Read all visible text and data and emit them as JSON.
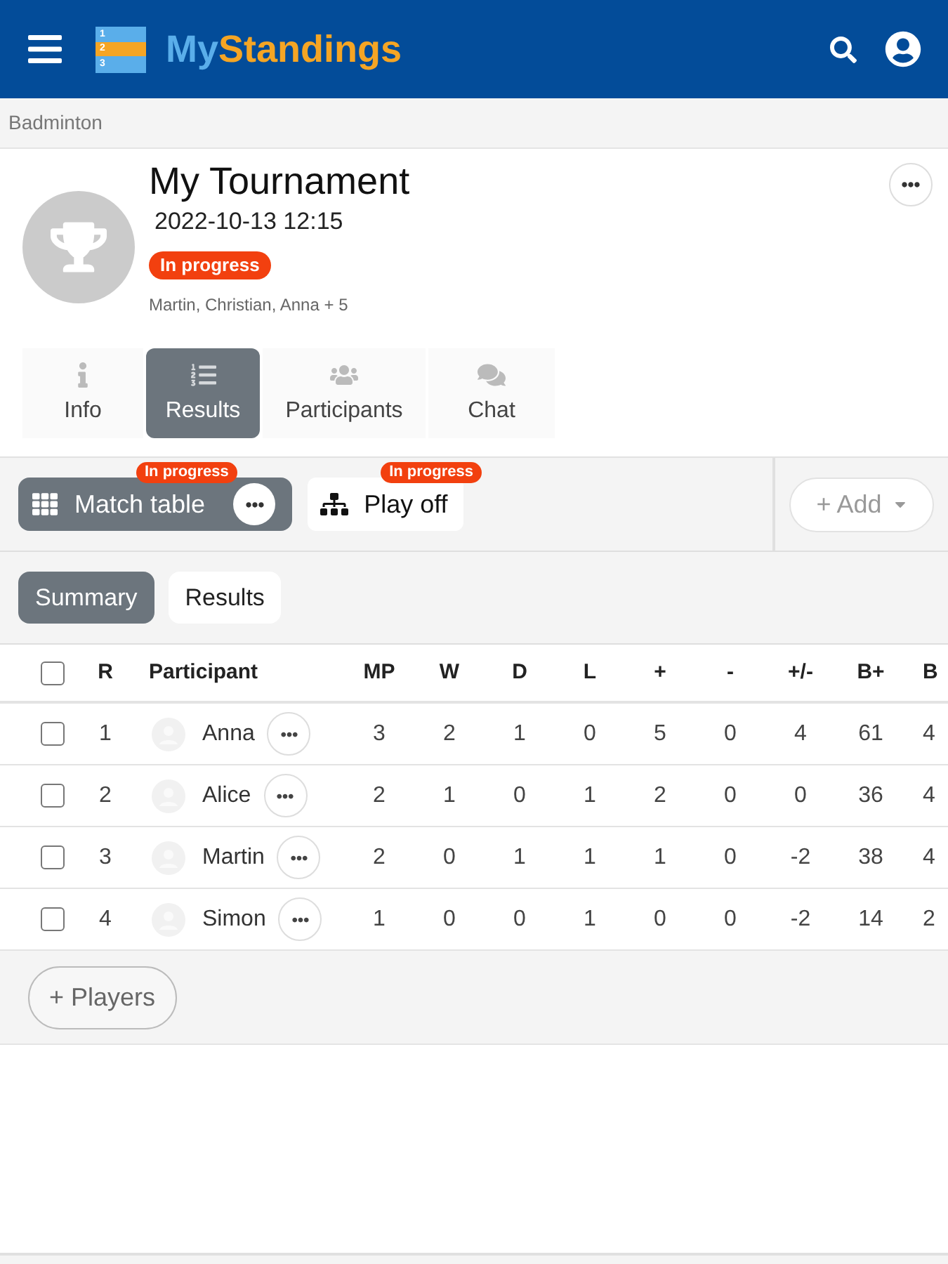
{
  "app_bar": {
    "logo": {
      "icon_numbers": [
        "1",
        "2",
        "3"
      ],
      "name_first": "My",
      "name_second": "Standings"
    }
  },
  "breadcrumb": "Badminton",
  "tournament": {
    "title": "My Tournament",
    "datetime": "2022-10-13 12:15",
    "status_badge": "In progress",
    "participants_summary": "Martin, Christian, Anna + 5"
  },
  "tabs": [
    {
      "label": "Info",
      "kind": "info",
      "selected": false
    },
    {
      "label": "Results",
      "kind": "list",
      "selected": true
    },
    {
      "label": "Participants",
      "kind": "people",
      "selected": false
    },
    {
      "label": "Chat",
      "kind": "chat",
      "selected": false
    }
  ],
  "stages": [
    {
      "label": "Match table",
      "kind": "table",
      "badge": "In progress",
      "selected": true
    },
    {
      "label": "Play off",
      "kind": "bracket",
      "badge": "In progress",
      "selected": false
    }
  ],
  "add_button": "+ Add",
  "views": [
    {
      "label": "Summary",
      "selected": true
    },
    {
      "label": "Results",
      "selected": false
    }
  ],
  "table": {
    "select_all_checked": false,
    "columns": [
      "R",
      "Participant",
      "MP",
      "W",
      "D",
      "L",
      "+",
      "-",
      "+/-",
      "B+",
      "B"
    ],
    "rows": [
      {
        "checked": false,
        "cells": [
          "1",
          "Anna",
          "3",
          "2",
          "1",
          "0",
          "5",
          "0",
          "4",
          "61",
          "4"
        ]
      },
      {
        "checked": false,
        "cells": [
          "2",
          "Alice",
          "2",
          "1",
          "0",
          "1",
          "2",
          "0",
          "0",
          "36",
          "4"
        ]
      },
      {
        "checked": false,
        "cells": [
          "3",
          "Martin",
          "2",
          "0",
          "1",
          "1",
          "1",
          "0",
          "-2",
          "38",
          "4"
        ]
      },
      {
        "checked": false,
        "cells": [
          "4",
          "Simon",
          "1",
          "0",
          "0",
          "1",
          "0",
          "0",
          "-2",
          "14",
          "2"
        ]
      }
    ]
  },
  "players_button": "+ Players"
}
